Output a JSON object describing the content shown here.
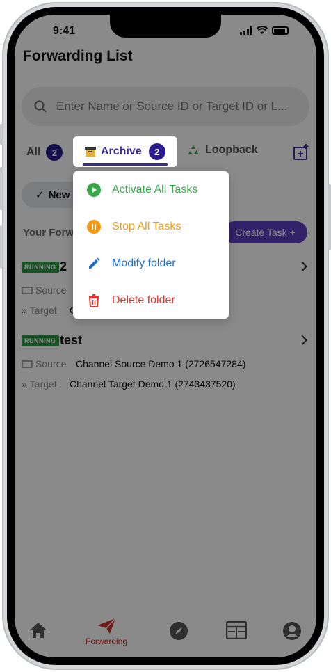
{
  "status": {
    "time": "9:41"
  },
  "header": {
    "title": "Forwarding List"
  },
  "search": {
    "placeholder": "Enter Name or Source ID or Target ID or L..."
  },
  "tabs": [
    {
      "label": "All",
      "count": "2"
    },
    {
      "label": "Archive",
      "count": "2"
    },
    {
      "label": "Loopback"
    }
  ],
  "filter": {
    "chip": "New"
  },
  "list": {
    "section_label": "Your Forw",
    "create_button": "Create Task +"
  },
  "tasks": [
    {
      "status": "RUNNING",
      "name": "2",
      "source_label": "Source",
      "target_label": "Target",
      "target_value": "C"
    },
    {
      "status": "RUNNING",
      "name": "test",
      "source_label": "Source",
      "source_value": "Channel Source Demo 1 (2726547284)",
      "target_label": "Target",
      "target_value": "Channel Target Demo 1 (2743437520)"
    }
  ],
  "menu": {
    "items": [
      {
        "label": "Activate All Tasks",
        "color": "#3aa64a"
      },
      {
        "label": "Stop All Tasks",
        "color": "#f29b12"
      },
      {
        "label": "Modify folder",
        "color": "#1e6fd0"
      },
      {
        "label": "Delete folder",
        "color": "#e0352b"
      }
    ]
  },
  "nav": {
    "active_label": "Forwarding"
  },
  "colors": {
    "accent": "#3b2a96",
    "active_nav": "#d0302c",
    "running": "#2e9a47"
  }
}
